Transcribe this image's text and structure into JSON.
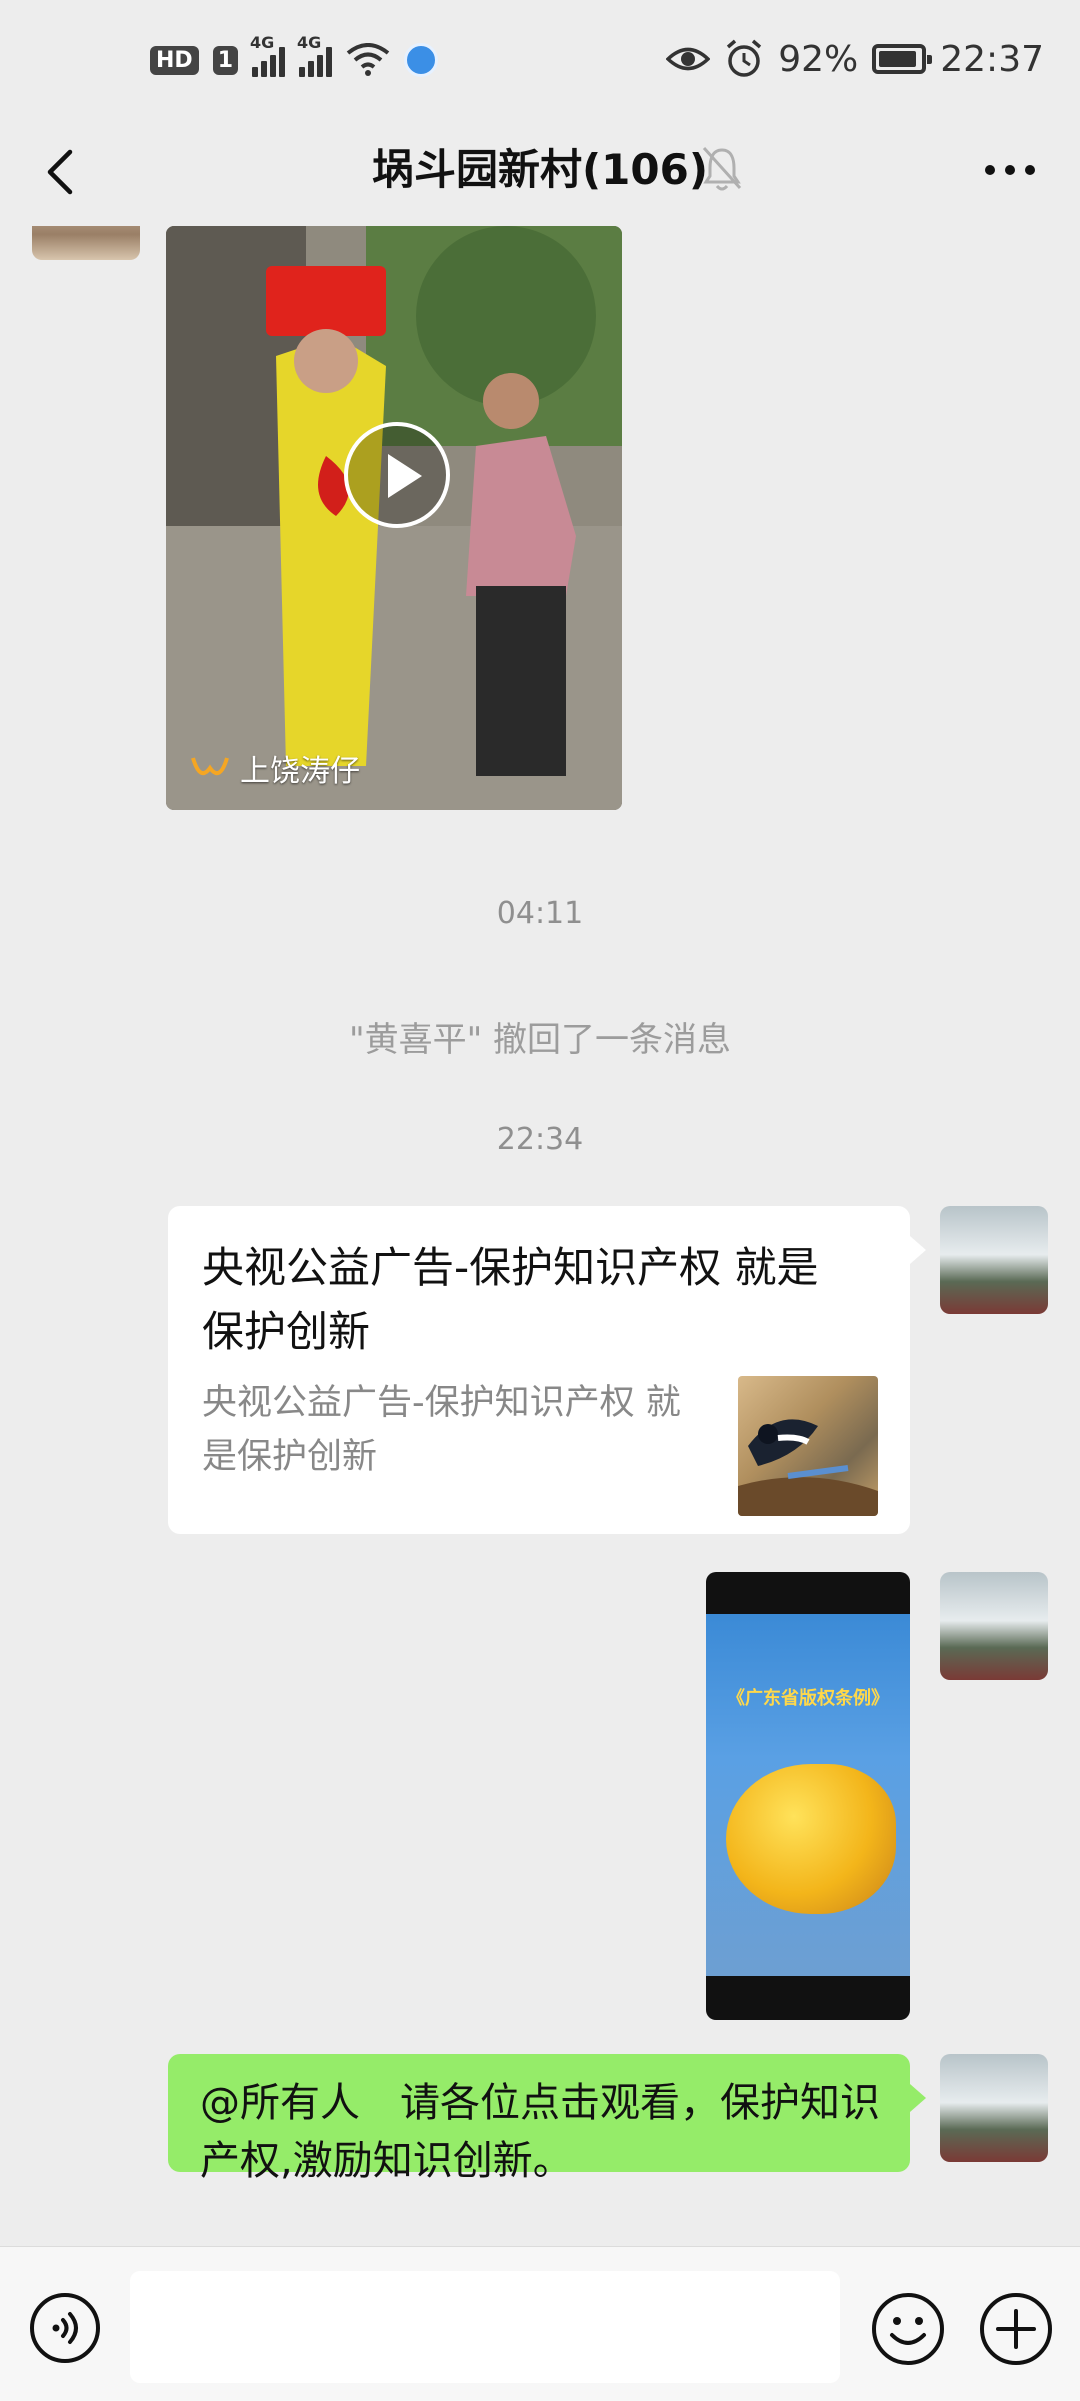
{
  "status_bar": {
    "hd": "HD",
    "sim": "1",
    "net1": "4G",
    "net2": "4G",
    "battery": "92%",
    "battery_level": 0.92,
    "time": "22:37"
  },
  "header": {
    "title": "埚斗园新村(106)",
    "icons": {
      "back": "back-arrow-icon",
      "mute": "bell-off-icon",
      "more": "more-dots-icon"
    }
  },
  "messages": {
    "video_label": "上饶涛仔",
    "time1": "04:11",
    "recall": "\"黄喜平\" 撤回了一条消息",
    "time2": "22:34",
    "link_title": "央视公益广告-保护知识产权 就是保护创新",
    "link_desc": "央视公益广告-保护知识产权 就是保护创新",
    "image_title": "《广东省版权条例》",
    "green_text": "@所有人　请各位点击观看，保护知识产权,激励知识创新。"
  },
  "input": {
    "value": "",
    "icons": {
      "voice": "voice-icon",
      "emoji": "emoji-icon",
      "plus": "plus-icon"
    }
  },
  "colors": {
    "background": "#ededed",
    "bubble_green": "#95ec69",
    "bubble_white": "#ffffff",
    "muted_text": "#9c9c9c"
  }
}
